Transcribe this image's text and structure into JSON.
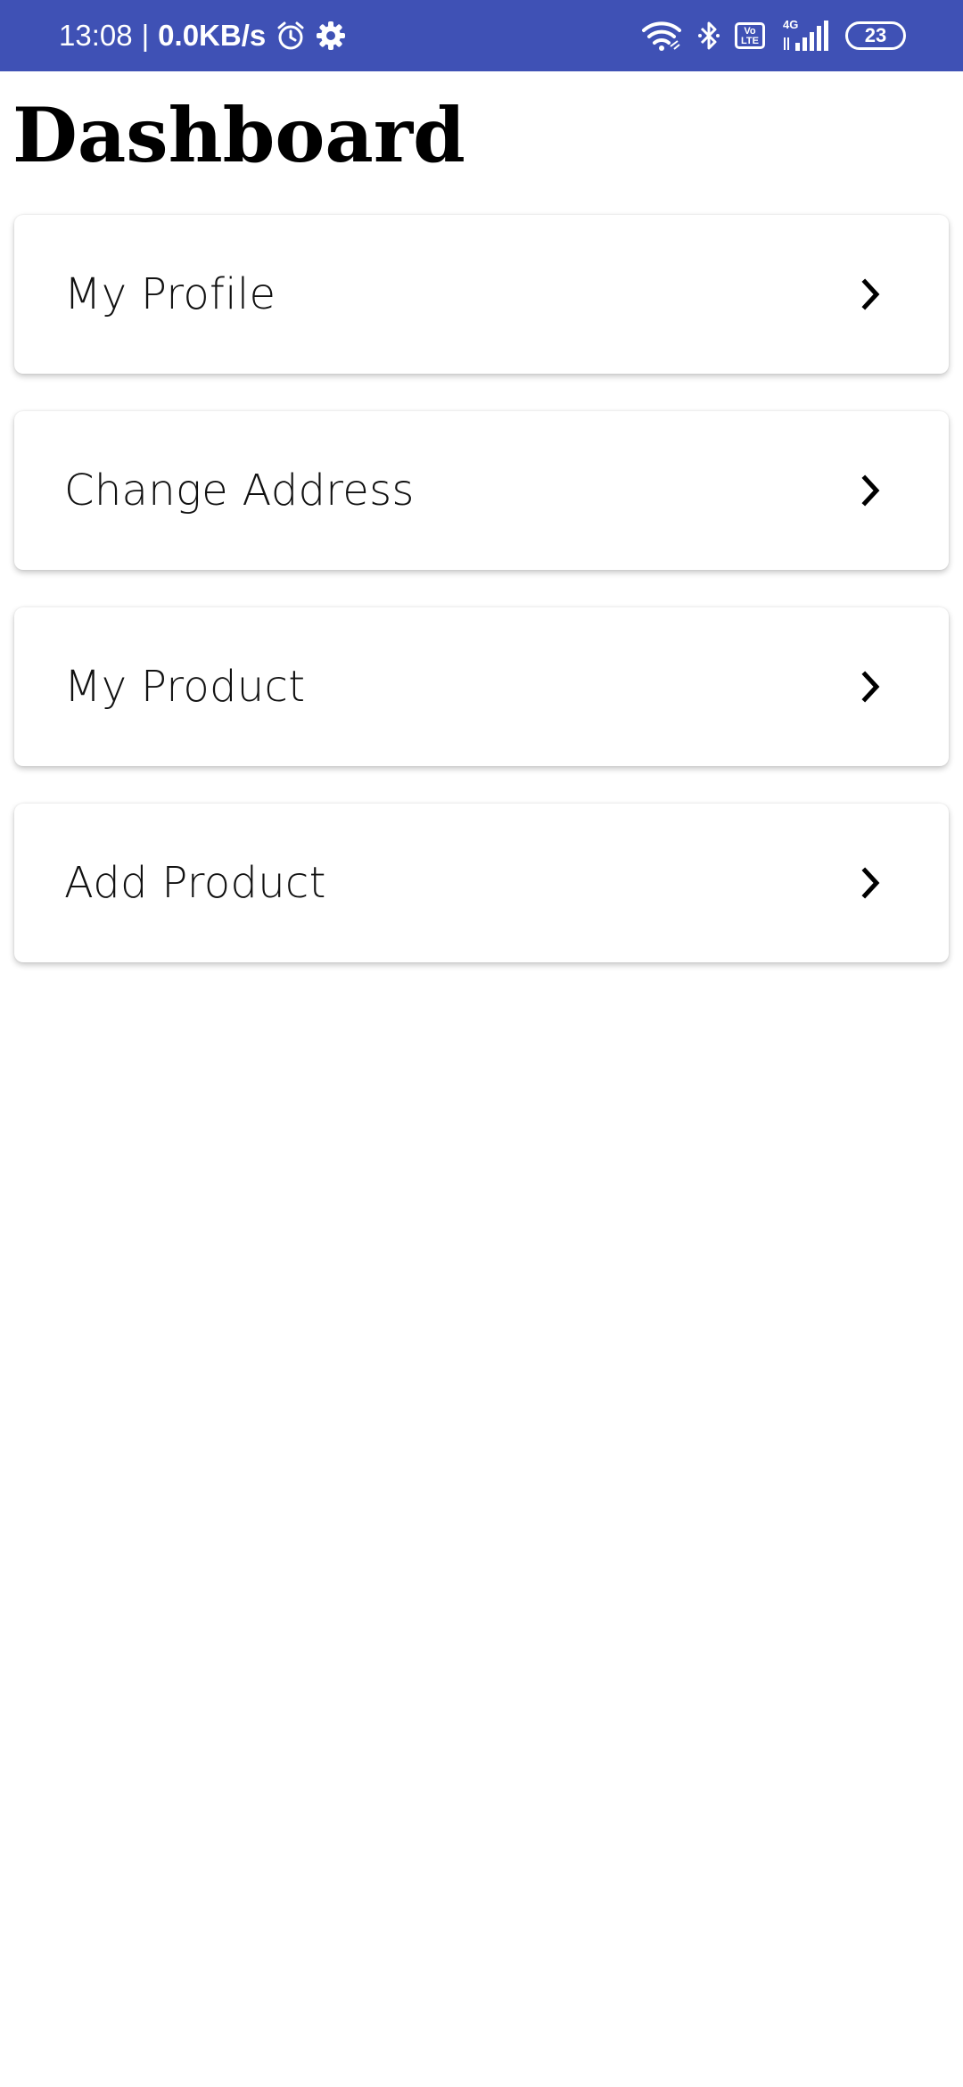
{
  "status_bar": {
    "time": "13:08",
    "separator": "|",
    "net_speed": "0.0KB/s",
    "icons": [
      "alarm-icon",
      "settings-icon",
      "wifi-icon",
      "bluetooth-icon",
      "volte-icon",
      "signal-4g-icon",
      "battery-icon"
    ],
    "volte_text_top": "Vo",
    "volte_text_bottom": "LTE",
    "network_type": "4G",
    "battery_level": "23",
    "background_color": "#3f51b5"
  },
  "page": {
    "title": "Dashboard"
  },
  "menu": {
    "items": [
      {
        "label": "My Profile",
        "icon": "chevron-right-icon"
      },
      {
        "label": "Change Address",
        "icon": "chevron-right-icon"
      },
      {
        "label": "My Product",
        "icon": "chevron-right-icon"
      },
      {
        "label": "Add Product",
        "icon": "chevron-right-icon"
      }
    ]
  }
}
